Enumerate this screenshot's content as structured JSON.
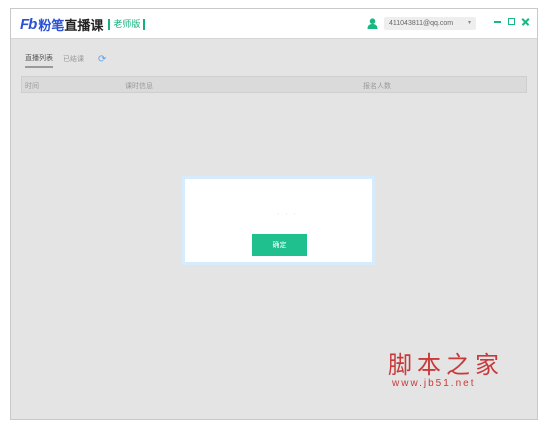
{
  "app": {
    "logo_mark": "Fb",
    "name_part1": "粉笔",
    "name_part2": "直播课",
    "edition": "老师版"
  },
  "user": {
    "icon": "user-icon",
    "email": "411043811@qq.com",
    "dropdown_icon": "caret-down-icon"
  },
  "window_controls": [
    "minimize-icon",
    "maximize-icon",
    "close-icon"
  ],
  "tabs": [
    {
      "label": "直播列表",
      "active": true
    },
    {
      "label": "已结课",
      "active": false
    }
  ],
  "refresh_icon": "refresh-icon",
  "table": {
    "columns": [
      "时间",
      "课时信息",
      "报名人数"
    ]
  },
  "dialog": {
    "message": "· · ·",
    "confirm_label": "确定"
  },
  "watermark": {
    "text": "脚本之家",
    "url": "www.jb51.net"
  },
  "colors": {
    "brand_blue": "#2a50d6",
    "accent_green": "#1fc08e",
    "watermark_red": "#c83a3a"
  }
}
